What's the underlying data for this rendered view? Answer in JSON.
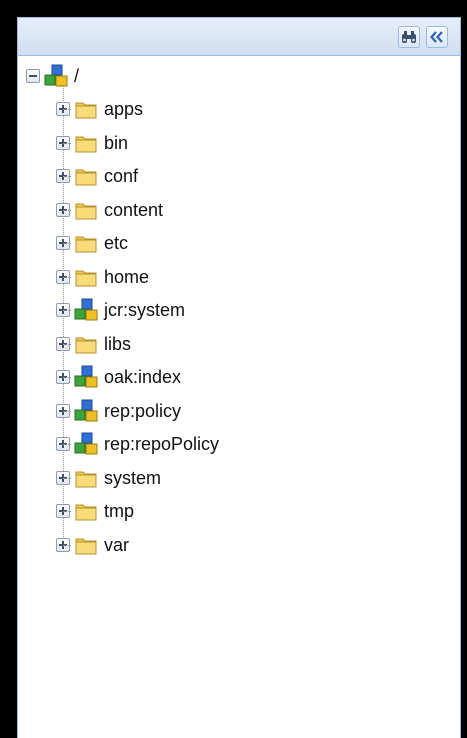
{
  "toolbar": {
    "find_icon": "binoculars-icon",
    "collapse_icon": "double-chevron-left-icon"
  },
  "tree": {
    "root": {
      "label": "/",
      "icon": "node-cubes-icon",
      "expanded": true
    },
    "children": [
      {
        "label": "apps",
        "icon": "folder-icon"
      },
      {
        "label": "bin",
        "icon": "folder-icon"
      },
      {
        "label": "conf",
        "icon": "folder-icon"
      },
      {
        "label": "content",
        "icon": "folder-icon"
      },
      {
        "label": "etc",
        "icon": "folder-icon"
      },
      {
        "label": "home",
        "icon": "folder-icon"
      },
      {
        "label": "jcr:system",
        "icon": "node-cubes-icon"
      },
      {
        "label": "libs",
        "icon": "folder-icon"
      },
      {
        "label": "oak:index",
        "icon": "node-cubes-icon"
      },
      {
        "label": "rep:policy",
        "icon": "node-cubes-icon"
      },
      {
        "label": "rep:repoPolicy",
        "icon": "node-cubes-icon"
      },
      {
        "label": "system",
        "icon": "folder-icon"
      },
      {
        "label": "tmp",
        "icon": "folder-icon"
      },
      {
        "label": "var",
        "icon": "folder-icon"
      }
    ]
  },
  "colors": {
    "panel_border": "#99bbe8",
    "header_bg": "#d0def0",
    "folder": "#f2c94c",
    "node_blue": "#2f6fd6",
    "node_green": "#3aa53a",
    "node_yellow": "#f0c020"
  }
}
